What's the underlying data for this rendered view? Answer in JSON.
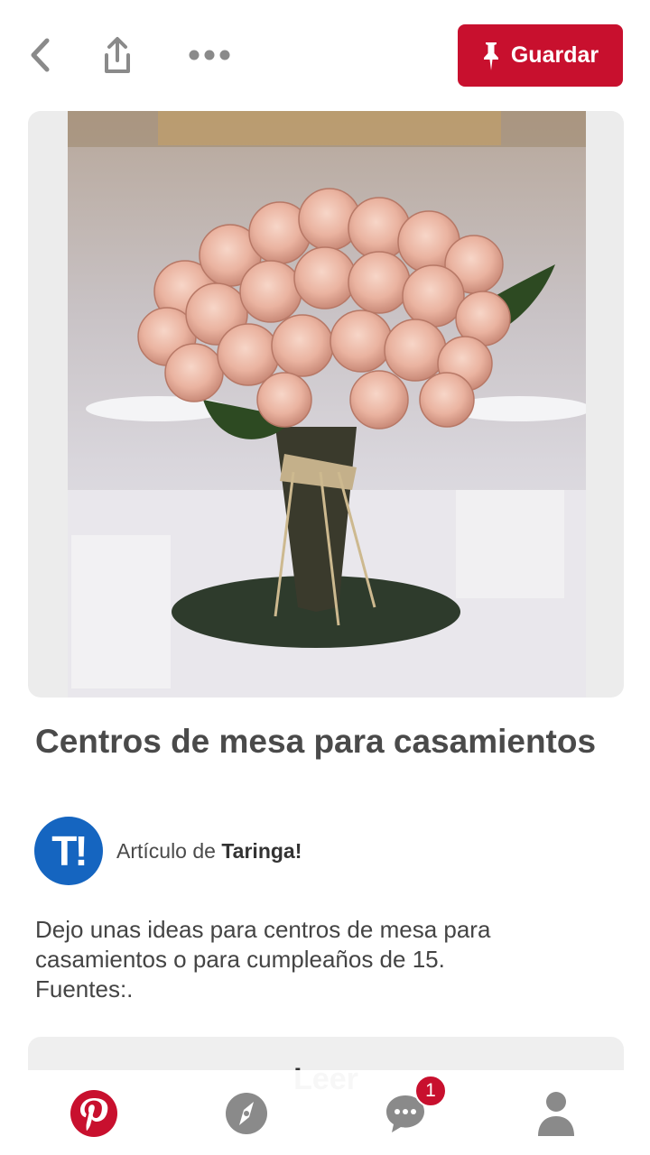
{
  "toolbar": {
    "back_icon": "chevron-left-icon",
    "share_icon": "share-icon",
    "more_icon": "more-dots-icon",
    "save_label": "Guardar",
    "save_icon": "pin-icon",
    "accent_color": "#c8102e"
  },
  "pin": {
    "image_description_icon": "roses-bouquet-photo",
    "expand_icon": "visual-search-icon",
    "title": "Centros de mesa para casamientos",
    "source": {
      "logo_text": "T!",
      "prefix": "Artículo de",
      "name": "Taringa!",
      "logo_color": "#1565c0"
    },
    "description": "Dejo unas ideas para centros de mesa para casamientos o para cumpleaños de 15. Fuentes:.",
    "read_label": "Leer"
  },
  "bottom_nav": {
    "items": [
      {
        "name": "home",
        "icon": "pinterest-logo-icon"
      },
      {
        "name": "explore",
        "icon": "compass-icon"
      },
      {
        "name": "messages",
        "icon": "chat-bubble-icon",
        "badge": "1"
      },
      {
        "name": "profile",
        "icon": "person-icon"
      }
    ]
  }
}
